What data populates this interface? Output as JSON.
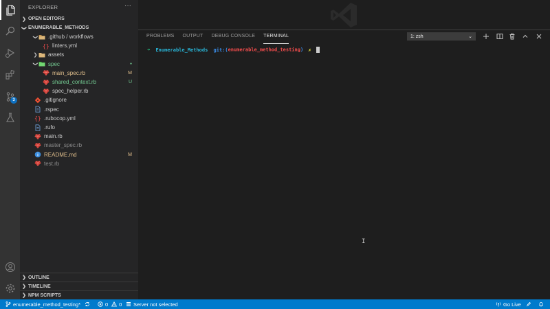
{
  "sidebar": {
    "title": "EXPLORER",
    "more": "···",
    "open_editors": "OPEN EDITORS",
    "project": "ENUMERABLE_METHODS",
    "outline": "OUTLINE",
    "timeline": "TIMELINE",
    "npm_scripts": "NPM SCRIPTS"
  },
  "tree": [
    {
      "label": ".github / workflows",
      "kind": "folder-open",
      "dec": "",
      "state": "normal"
    },
    {
      "label": "linters.yml",
      "kind": "yaml",
      "dec": "",
      "state": "normal"
    },
    {
      "label": "assets",
      "kind": "folder",
      "dec": "",
      "state": "normal"
    },
    {
      "label": "spec",
      "kind": "folder-spec",
      "dec": "●",
      "state": "untracked"
    },
    {
      "label": "main_spec.rb",
      "kind": "ruby",
      "dec": "M",
      "state": "mod"
    },
    {
      "label": "shared_context.rb",
      "kind": "ruby",
      "dec": "U",
      "state": "untracked"
    },
    {
      "label": "spec_helper.rb",
      "kind": "ruby",
      "dec": "",
      "state": "normal"
    },
    {
      "label": ".gitignore",
      "kind": "git",
      "dec": "",
      "state": "normal"
    },
    {
      "label": ".rspec",
      "kind": "file",
      "dec": "",
      "state": "normal"
    },
    {
      "label": ".rubocop.yml",
      "kind": "yaml",
      "dec": "",
      "state": "normal"
    },
    {
      "label": ".rufo",
      "kind": "file",
      "dec": "",
      "state": "normal"
    },
    {
      "label": "main.rb",
      "kind": "ruby",
      "dec": "",
      "state": "normal"
    },
    {
      "label": "master_spec.rb",
      "kind": "ruby",
      "dec": "",
      "state": "ignored"
    },
    {
      "label": "README.md",
      "kind": "info",
      "dec": "M",
      "state": "mod"
    },
    {
      "label": "test.rb",
      "kind": "ruby",
      "dec": "",
      "state": "ignored"
    }
  ],
  "activity": {
    "scm_badge": "3"
  },
  "panel": {
    "tabs": [
      "PROBLEMS",
      "OUTPUT",
      "DEBUG CONSOLE",
      "TERMINAL"
    ],
    "active_tab": "TERMINAL",
    "terminal_select": "1: zsh",
    "prompt_arrow": "➜",
    "prompt_dir": "Enumerable_Methods",
    "prompt_git": "git:(",
    "prompt_branch": "enumerable_method_testing",
    "prompt_git_close": ")",
    "prompt_x": "✗"
  },
  "status": {
    "branch": "enumerable_method_testing*",
    "errors": "0",
    "warnings": "0",
    "server": "Server not selected",
    "go_live": "Go Live"
  },
  "colors": {
    "status_bar": "#007acc",
    "activity_bar": "#333333",
    "sidebar": "#252526",
    "editor": "#1e1e1e",
    "modified": "#e2c08d",
    "untracked": "#73c991"
  }
}
